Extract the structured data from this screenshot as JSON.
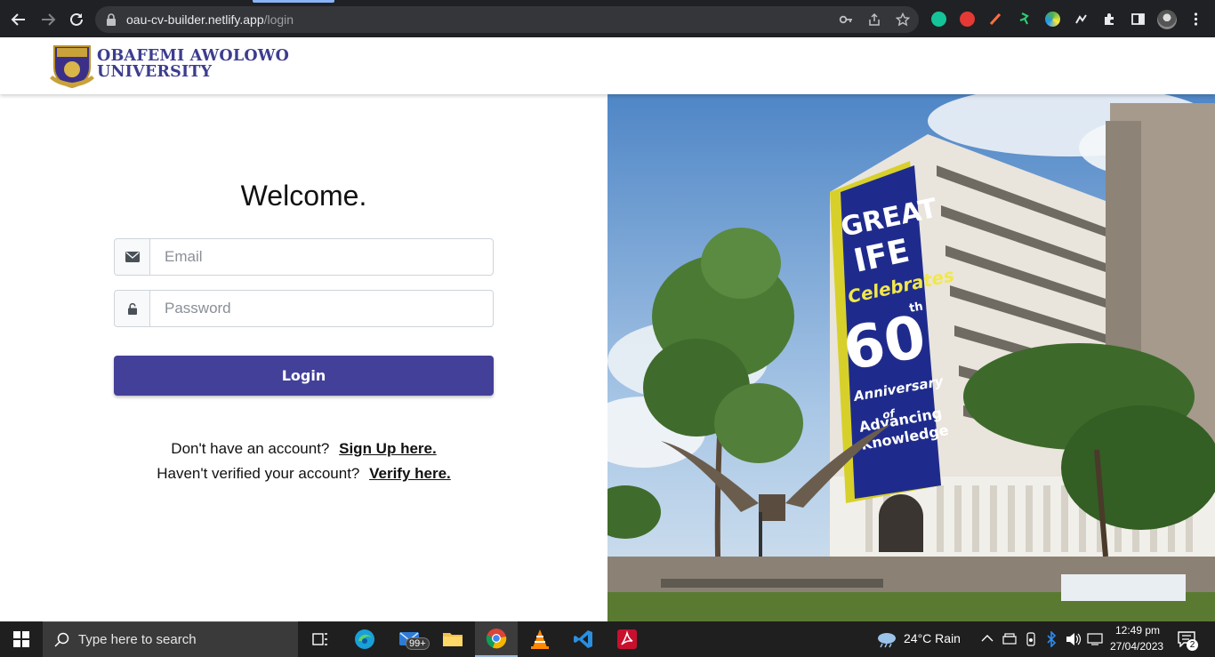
{
  "browser": {
    "url_host": "oau-cv-builder.netlify.app",
    "url_path": "/login"
  },
  "header": {
    "logo_line1": "OBAFEMI AWOLOWO",
    "logo_line2": "UNIVERSITY"
  },
  "login": {
    "title": "Welcome.",
    "email_placeholder": "Email",
    "password_placeholder": "Password",
    "button_label": "Login",
    "signup_prompt": "Don't have an account?",
    "signup_link": "Sign Up here.",
    "verify_prompt": "Haven't verified your account?",
    "verify_link": "Verify here."
  },
  "photo": {
    "banner_great": "GREAT",
    "banner_ife": "IFE",
    "banner_celebrates": "Celebrates",
    "banner_60": "60",
    "banner_th": "th",
    "banner_anniversary": "Anniversary",
    "banner_of": "of",
    "banner_advancing": "Advancing",
    "banner_knowledge": "Knowledge"
  },
  "taskbar": {
    "search_placeholder": "Type here to search",
    "mail_badge": "99+",
    "weather": "24°C  Rain",
    "time": "12:49 pm",
    "date": "27/04/2023",
    "notification_count": "2"
  },
  "colors": {
    "brand": "#43409a",
    "logo_text": "#3d3d8f",
    "chrome_bg": "#202124",
    "taskbar_bg": "#1f1f1f"
  }
}
